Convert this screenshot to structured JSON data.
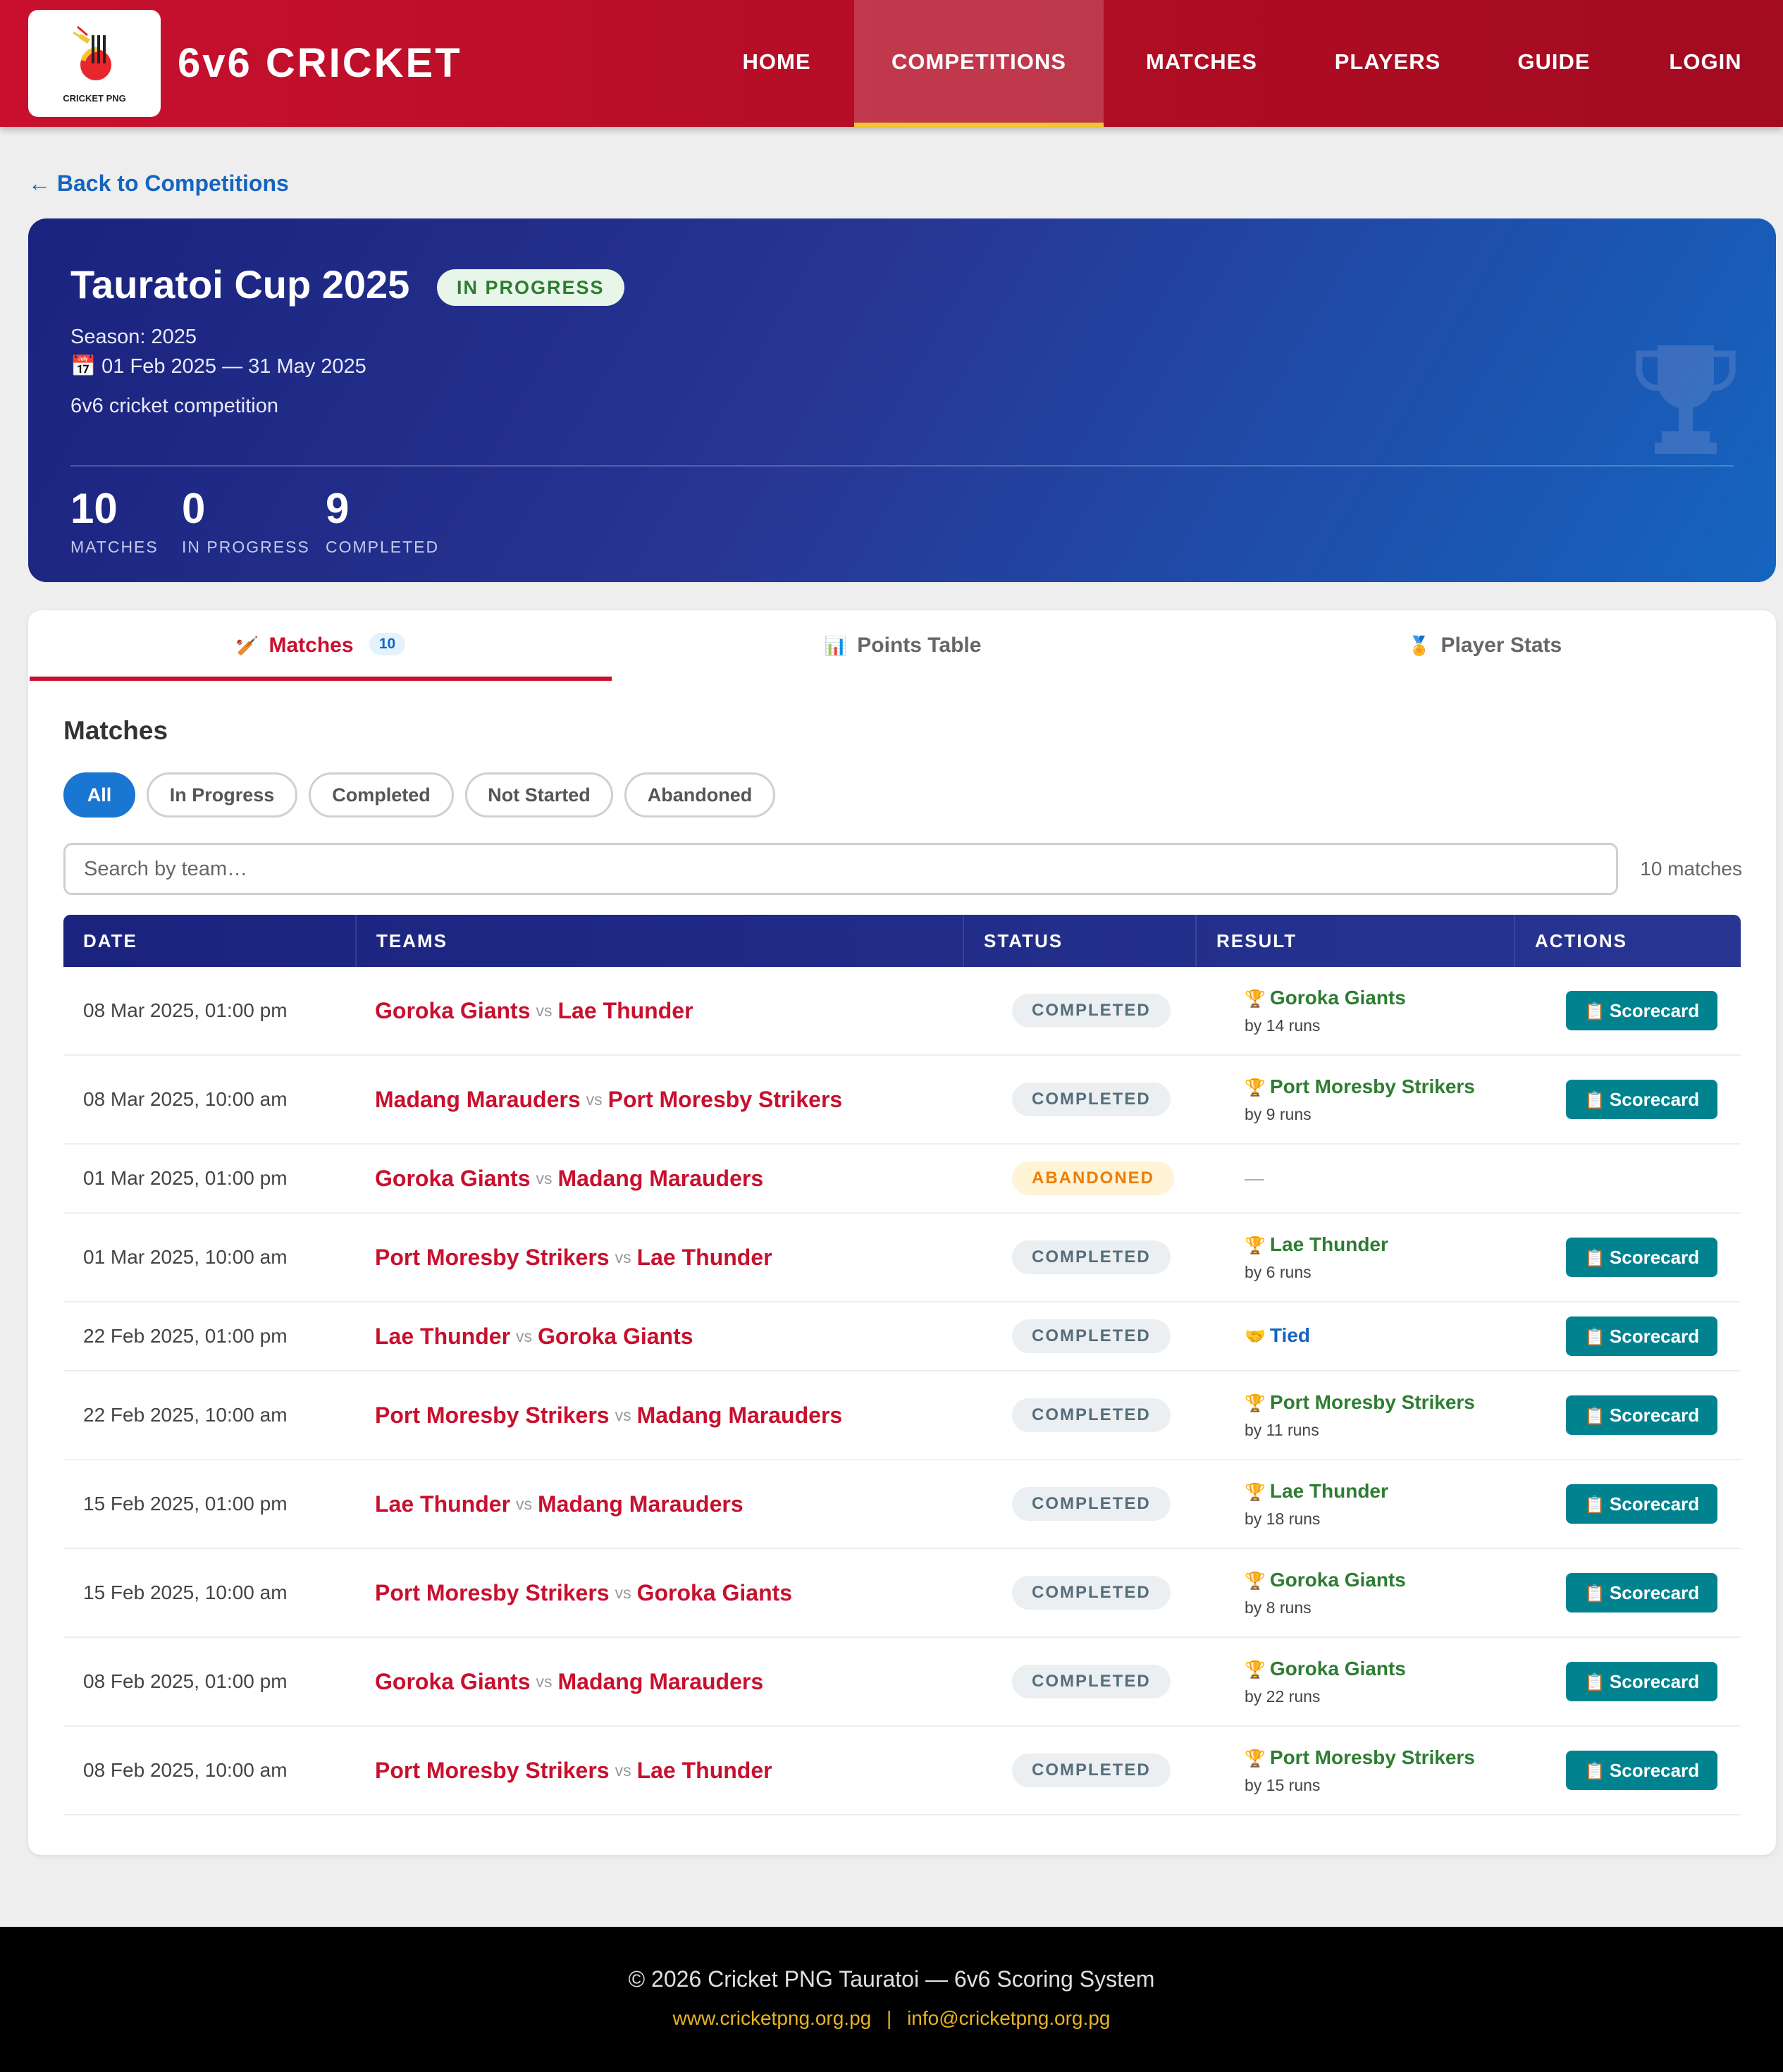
{
  "header": {
    "logo_text": "CRICKET PNG",
    "brand": "6v6 CRICKET",
    "nav": [
      {
        "label": "HOME",
        "active": false
      },
      {
        "label": "COMPETITIONS",
        "active": true
      },
      {
        "label": "MATCHES",
        "active": false
      },
      {
        "label": "PLAYERS",
        "active": false
      },
      {
        "label": "GUIDE",
        "active": false
      },
      {
        "label": "LOGIN",
        "active": false
      }
    ]
  },
  "back_link": "Back to Competitions",
  "competition": {
    "title": "Tauratoi Cup 2025",
    "status_badge": "IN PROGRESS",
    "season": "Season: 2025",
    "dates": "01 Feb 2025 — 31 May 2025",
    "description": "6v6 cricket competition",
    "stats": [
      {
        "value": "10",
        "label": "MATCHES"
      },
      {
        "value": "0",
        "label": "IN PROGRESS"
      },
      {
        "value": "9",
        "label": "COMPLETED"
      }
    ]
  },
  "tabs": [
    {
      "icon": "cricket-bat-icon",
      "label": "Matches",
      "count": "10",
      "active": true
    },
    {
      "icon": "bar-chart-icon",
      "label": "Points Table",
      "active": false
    },
    {
      "icon": "medal-icon",
      "label": "Player Stats",
      "active": false
    }
  ],
  "matches_section": {
    "title": "Matches",
    "filters": [
      {
        "label": "All",
        "active": true
      },
      {
        "label": "In Progress",
        "active": false
      },
      {
        "label": "Completed",
        "active": false
      },
      {
        "label": "Not Started",
        "active": false
      },
      {
        "label": "Abandoned",
        "active": false
      }
    ],
    "search_placeholder": "Search by team…",
    "match_count": "10 matches",
    "columns": [
      "DATE",
      "TEAMS",
      "STATUS",
      "RESULT",
      "ACTIONS"
    ],
    "vs_label": "vs",
    "scorecard_label": "Scorecard",
    "rows": [
      {
        "date": "08 Mar 2025, 01:00 pm",
        "team1": "Goroka Giants",
        "team2": "Lae Thunder",
        "status": "COMPLETED",
        "result_type": "win",
        "winner": "Goroka Giants",
        "margin": "by 14 runs"
      },
      {
        "date": "08 Mar 2025, 10:00 am",
        "team1": "Madang Marauders",
        "team2": "Port Moresby Strikers",
        "status": "COMPLETED",
        "result_type": "win",
        "winner": "Port Moresby Strikers",
        "margin": "by 9 runs"
      },
      {
        "date": "01 Mar 2025, 01:00 pm",
        "team1": "Goroka Giants",
        "team2": "Madang Marauders",
        "status": "ABANDONED",
        "result_type": "none",
        "result_text": "—"
      },
      {
        "date": "01 Mar 2025, 10:00 am",
        "team1": "Port Moresby Strikers",
        "team2": "Lae Thunder",
        "status": "COMPLETED",
        "result_type": "win",
        "winner": "Lae Thunder",
        "margin": "by 6 runs"
      },
      {
        "date": "22 Feb 2025, 01:00 pm",
        "team1": "Lae Thunder",
        "team2": "Goroka Giants",
        "status": "COMPLETED",
        "result_type": "tied",
        "result_text": "Tied"
      },
      {
        "date": "22 Feb 2025, 10:00 am",
        "team1": "Port Moresby Strikers",
        "team2": "Madang Marauders",
        "status": "COMPLETED",
        "result_type": "win",
        "winner": "Port Moresby Strikers",
        "margin": "by 11 runs"
      },
      {
        "date": "15 Feb 2025, 01:00 pm",
        "team1": "Lae Thunder",
        "team2": "Madang Marauders",
        "status": "COMPLETED",
        "result_type": "win",
        "winner": "Lae Thunder",
        "margin": "by 18 runs"
      },
      {
        "date": "15 Feb 2025, 10:00 am",
        "team1": "Port Moresby Strikers",
        "team2": "Goroka Giants",
        "status": "COMPLETED",
        "result_type": "win",
        "winner": "Goroka Giants",
        "margin": "by 8 runs"
      },
      {
        "date": "08 Feb 2025, 01:00 pm",
        "team1": "Goroka Giants",
        "team2": "Madang Marauders",
        "status": "COMPLETED",
        "result_type": "win",
        "winner": "Goroka Giants",
        "margin": "by 22 runs"
      },
      {
        "date": "08 Feb 2025, 10:00 am",
        "team1": "Port Moresby Strikers",
        "team2": "Lae Thunder",
        "status": "COMPLETED",
        "result_type": "win",
        "winner": "Port Moresby Strikers",
        "margin": "by 15 runs"
      }
    ]
  },
  "footer": {
    "copyright": "© 2026 Cricket PNG Tauratoi — 6v6 Scoring System",
    "website": "www.cricketpng.org.pg",
    "separator": "|",
    "email": "info@cricketpng.org.pg"
  },
  "colors": {
    "brand_red": "#c8102e",
    "hero_navy": "#1a237e",
    "hero_blue": "#1565c0",
    "accent_yellow": "#f4c430",
    "win_green": "#2e7d32",
    "scorecard_teal": "#00838f"
  }
}
